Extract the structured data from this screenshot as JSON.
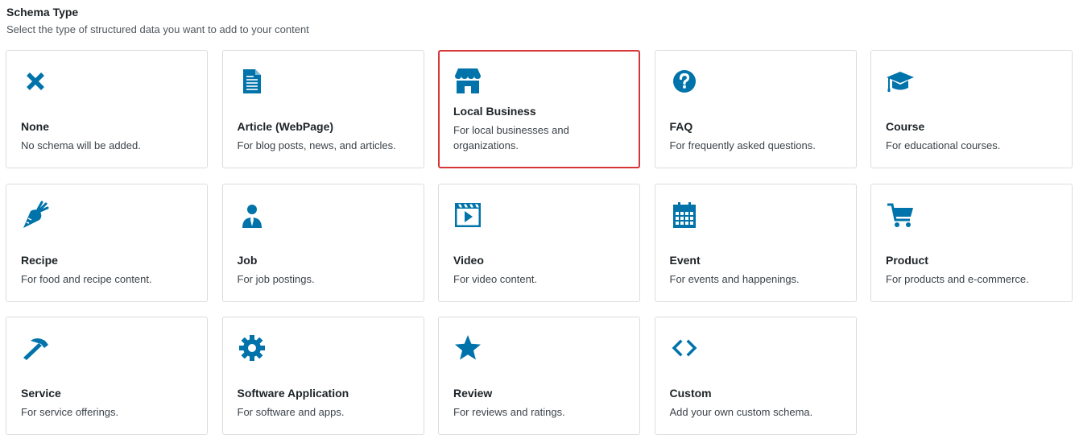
{
  "header": {
    "title": "Schema Type",
    "subtitle": "Select the type of structured data you want to add to your content"
  },
  "accent_color": "#0073aa",
  "selected_border_color": "#d63638",
  "cards": [
    {
      "label": "None",
      "desc": "No schema will be added.",
      "icon": "close-icon"
    },
    {
      "label": "Article (WebPage)",
      "desc": "For blog posts, news, and articles.",
      "icon": "document-icon"
    },
    {
      "label": "Local Business",
      "desc": "For local businesses and organizations.",
      "icon": "store-icon",
      "selected": true
    },
    {
      "label": "FAQ",
      "desc": "For frequently asked questions.",
      "icon": "question-circle-icon"
    },
    {
      "label": "Course",
      "desc": "For educational courses.",
      "icon": "graduation-cap-icon"
    },
    {
      "label": "Recipe",
      "desc": "For food and recipe content.",
      "icon": "carrot-icon"
    },
    {
      "label": "Job",
      "desc": "For job postings.",
      "icon": "user-tie-icon"
    },
    {
      "label": "Video",
      "desc": "For video content.",
      "icon": "video-icon"
    },
    {
      "label": "Event",
      "desc": "For events and happenings.",
      "icon": "calendar-icon"
    },
    {
      "label": "Product",
      "desc": "For products and e-commerce.",
      "icon": "cart-icon"
    },
    {
      "label": "Service",
      "desc": "For service offerings.",
      "icon": "hammer-icon"
    },
    {
      "label": "Software Application",
      "desc": "For software and apps.",
      "icon": "gear-icon"
    },
    {
      "label": "Review",
      "desc": "For reviews and ratings.",
      "icon": "star-icon"
    },
    {
      "label": "Custom",
      "desc": "Add your own custom schema.",
      "icon": "code-icon"
    }
  ]
}
